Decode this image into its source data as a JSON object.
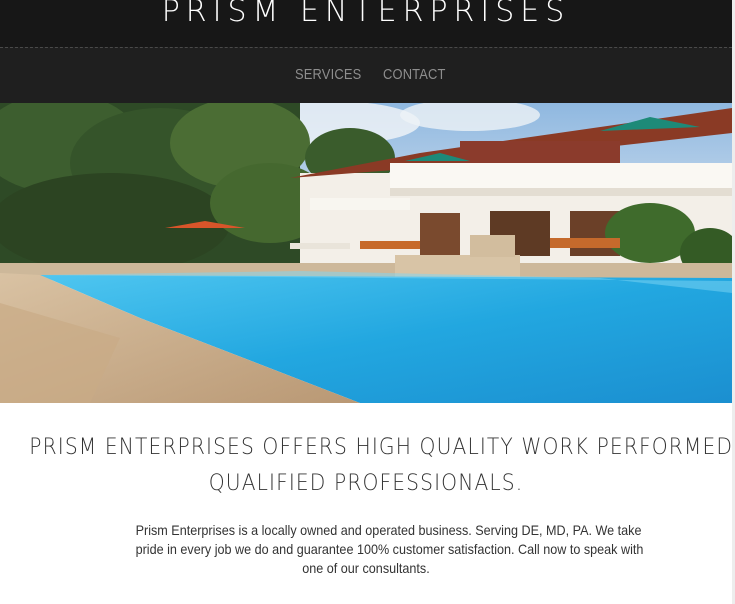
{
  "header": {
    "brand": "PRISM ENTERPRISES"
  },
  "nav": {
    "items": [
      {
        "label": "SERVICES"
      },
      {
        "label": "CONTACT"
      }
    ]
  },
  "hero": {
    "image": "luxury-villa-pool-photo"
  },
  "content": {
    "headline_lines": [
      "PRISM ENTERPRISES OFFERS HIGH QUALITY WORK PERFORMED BY",
      "QUALIFIED PROFESSIONALS."
    ],
    "body_lines": [
      "Prism Enterprises is a locally owned and operated business. Serving DE, MD, PA. We take",
      "pride in every job we do and guarantee 100% customer satisfaction. Call now to speak with",
      "one of our consultants."
    ]
  },
  "colors": {
    "header_bg": "#171717",
    "nav_bg": "#1f1f1f",
    "nav_text": "#8e8e8e",
    "pool": "#2aa9de",
    "text": "#333333"
  }
}
